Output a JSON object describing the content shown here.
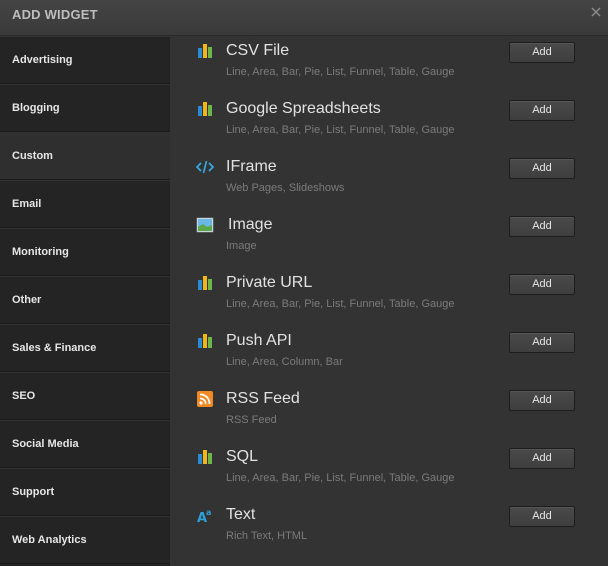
{
  "header": {
    "title": "ADD WIDGET"
  },
  "sidebar": {
    "items": [
      {
        "label": "Advertising"
      },
      {
        "label": "Blogging"
      },
      {
        "label": "Custom",
        "active": true
      },
      {
        "label": "Email"
      },
      {
        "label": "Monitoring"
      },
      {
        "label": "Other"
      },
      {
        "label": "Sales & Finance"
      },
      {
        "label": "SEO"
      },
      {
        "label": "Social Media"
      },
      {
        "label": "Support"
      },
      {
        "label": "Web Analytics"
      }
    ]
  },
  "widgets": [
    {
      "title": "CSV File",
      "desc": "Line, Area, Bar, Pie, List, Funnel, Table, Gauge",
      "icon": "bar-chart-icon",
      "button": "Add"
    },
    {
      "title": "Google Spreadsheets",
      "desc": "Line, Area, Bar, Pie, List, Funnel, Table, Gauge",
      "icon": "bar-chart-icon",
      "button": "Add"
    },
    {
      "title": "IFrame",
      "desc": "Web Pages, Slideshows",
      "icon": "code-icon",
      "button": "Add"
    },
    {
      "title": "Image",
      "desc": "Image",
      "icon": "image-icon",
      "button": "Add"
    },
    {
      "title": "Private URL",
      "desc": "Line, Area, Bar, Pie, List, Funnel, Table, Gauge",
      "icon": "bar-chart-icon",
      "button": "Add"
    },
    {
      "title": "Push API",
      "desc": "Line, Area, Column, Bar",
      "icon": "bar-chart-icon",
      "button": "Add"
    },
    {
      "title": "RSS Feed",
      "desc": "RSS Feed",
      "icon": "rss-icon",
      "button": "Add"
    },
    {
      "title": "SQL",
      "desc": "Line, Area, Bar, Pie, List, Funnel, Table, Gauge",
      "icon": "bar-chart-icon",
      "button": "Add"
    },
    {
      "title": "Text",
      "desc": "Rich Text, HTML",
      "icon": "text-icon",
      "button": "Add"
    }
  ],
  "colors": {
    "bar_blue": "#2a8ad4",
    "bar_yellow": "#f2b616",
    "bar_green": "#6fb64a",
    "code": "#36a9e1",
    "rss": "#f08a24",
    "text_icon": "#2f9fd8"
  }
}
